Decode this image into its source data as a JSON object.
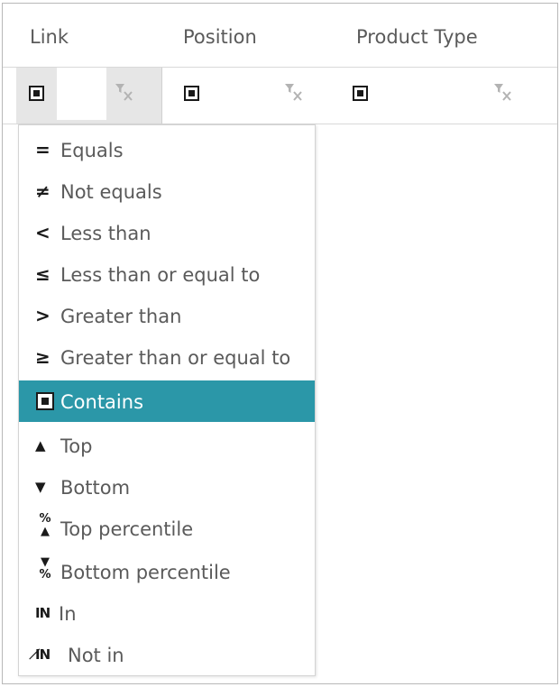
{
  "columns": [
    {
      "label": "Link"
    },
    {
      "label": "Position"
    },
    {
      "label": "Product Type"
    }
  ],
  "filter_row": {
    "link_input_value": "",
    "icons": {
      "operator": "contains-icon",
      "clear": "clear-filter-icon"
    }
  },
  "dropdown": {
    "items": [
      {
        "label": "Equals",
        "icon": "equals-icon",
        "glyph": "="
      },
      {
        "label": "Not equals",
        "icon": "not-equals-icon",
        "glyph": "≠"
      },
      {
        "label": "Less than",
        "icon": "less-than-icon",
        "glyph": "<"
      },
      {
        "label": "Less than or equal to",
        "icon": "less-than-or-equal-icon",
        "glyph": "≤"
      },
      {
        "label": "Greater than",
        "icon": "greater-than-icon",
        "glyph": ">"
      },
      {
        "label": "Greater than or equal to",
        "icon": "greater-than-or-equal-icon",
        "glyph": "≥"
      },
      {
        "label": "Contains",
        "icon": "contains-icon",
        "glyph": "",
        "selected": true
      },
      {
        "label": "Top",
        "icon": "top-icon",
        "glyph": "▲"
      },
      {
        "label": "Bottom",
        "icon": "bottom-icon",
        "glyph": "▼"
      },
      {
        "label": "Top percentile",
        "icon": "top-percentile-icon",
        "glyph_top": "%",
        "glyph_bottom": "▲"
      },
      {
        "label": "Bottom percentile",
        "icon": "bottom-percentile-icon",
        "glyph_top": "▼",
        "glyph_bottom": "%"
      },
      {
        "label": "In",
        "icon": "in-icon",
        "glyph": "IN"
      },
      {
        "label": "Not in",
        "icon": "not-in-icon",
        "glyph": "I̸N"
      }
    ]
  },
  "colors": {
    "selected_background": "#2b97a8",
    "active_filter_cell": "#e6e6e6",
    "header_text": "#5a5a5a"
  }
}
